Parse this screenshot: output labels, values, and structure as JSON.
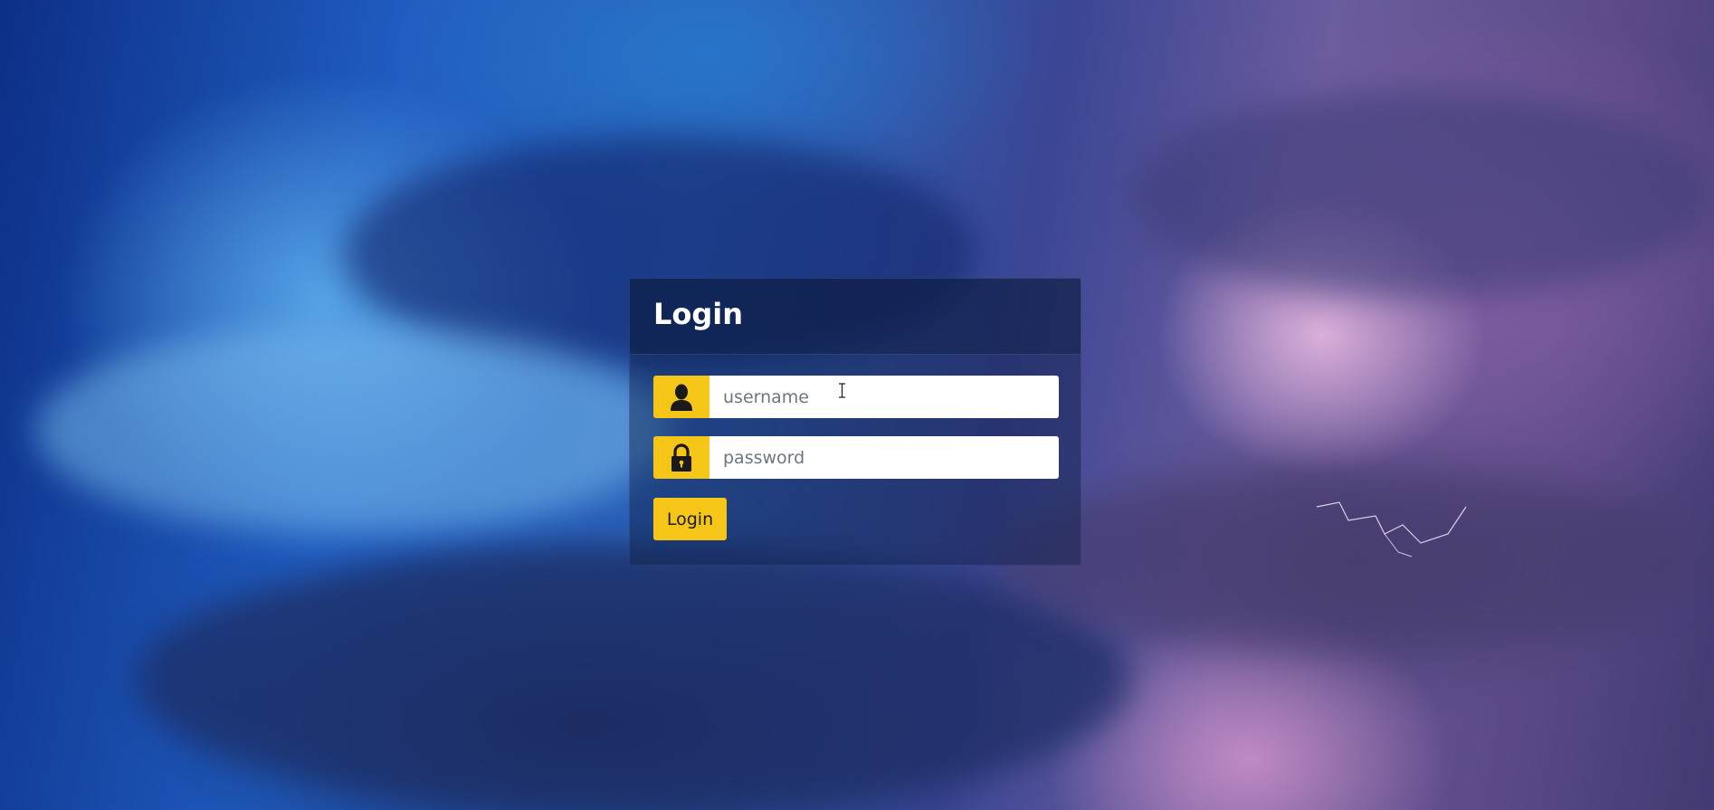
{
  "background": {
    "description_colors": [
      "#0d2f86",
      "#2a61b8",
      "#6b5c9e",
      "#ecbee4"
    ]
  },
  "login_card": {
    "title": "Login",
    "username": {
      "icon": "user-icon",
      "placeholder": "username",
      "value": ""
    },
    "password": {
      "icon": "lock-icon",
      "placeholder": "password",
      "value": ""
    },
    "submit_label": "Login"
  },
  "colors": {
    "accent": "#f5c518",
    "card_bg": "rgba(15,30,70,0.45)",
    "title_text": "#ffffff"
  }
}
